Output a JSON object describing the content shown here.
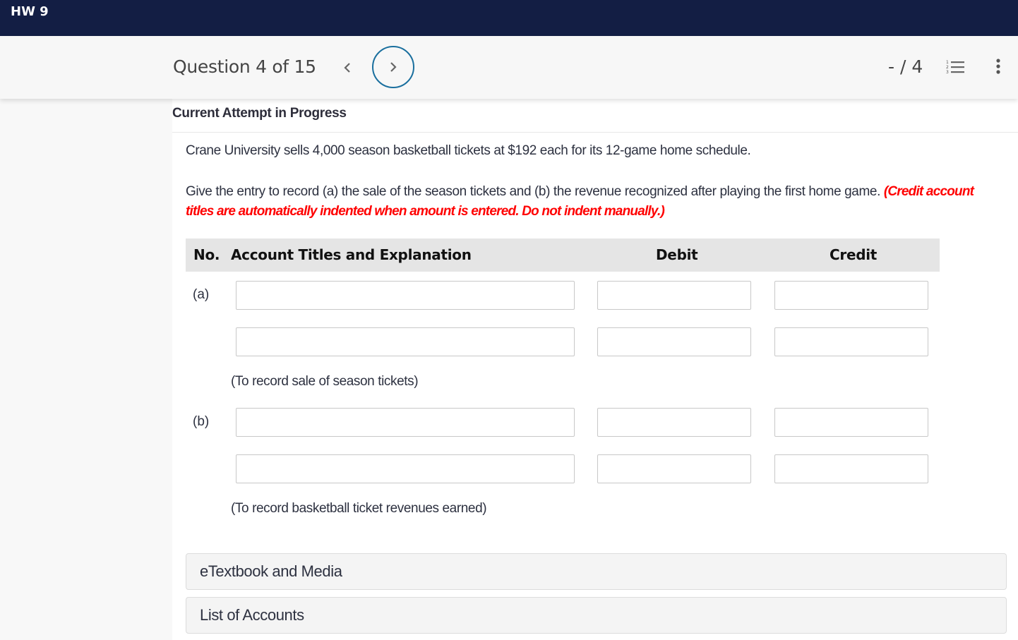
{
  "topbar": {
    "title": "HW 9"
  },
  "question_header": {
    "label": "Question 4 of 15",
    "prev_icon": "<",
    "next_icon": ">",
    "score": "- / 4",
    "list_icon": "numbered-list-icon",
    "more_icon": "kebab-menu-icon"
  },
  "main": {
    "attempt_label": "Current Attempt in Progress",
    "problem_text": "Crane University sells 4,000 season basketball tickets at $192 each for its 12-game home schedule.",
    "instruction_text": "Give the entry to record (a) the sale of the season tickets and (b) the revenue recognized after playing the first home game. ",
    "instruction_note": "(Credit account titles are automatically indented when amount is entered. Do not indent manually.)",
    "table": {
      "headers": {
        "no": "No.",
        "account": "Account Titles and Explanation",
        "debit": "Debit",
        "credit": "Credit"
      },
      "entries": [
        {
          "label": "(a)",
          "rows": [
            {
              "account": "",
              "debit": "",
              "credit": ""
            },
            {
              "account": "",
              "debit": "",
              "credit": ""
            }
          ],
          "explanation": "(To record sale of season tickets)"
        },
        {
          "label": "(b)",
          "rows": [
            {
              "account": "",
              "debit": "",
              "credit": ""
            },
            {
              "account": "",
              "debit": "",
              "credit": ""
            }
          ],
          "explanation": "(To record basketball ticket revenues earned)"
        }
      ]
    },
    "accordions": [
      {
        "label": "eTextbook and Media"
      },
      {
        "label": "List of Accounts"
      }
    ]
  },
  "colors": {
    "topbar_bg": "#131e44",
    "next_button_ring": "#1a6f9e",
    "note_red": "#ff0000"
  }
}
